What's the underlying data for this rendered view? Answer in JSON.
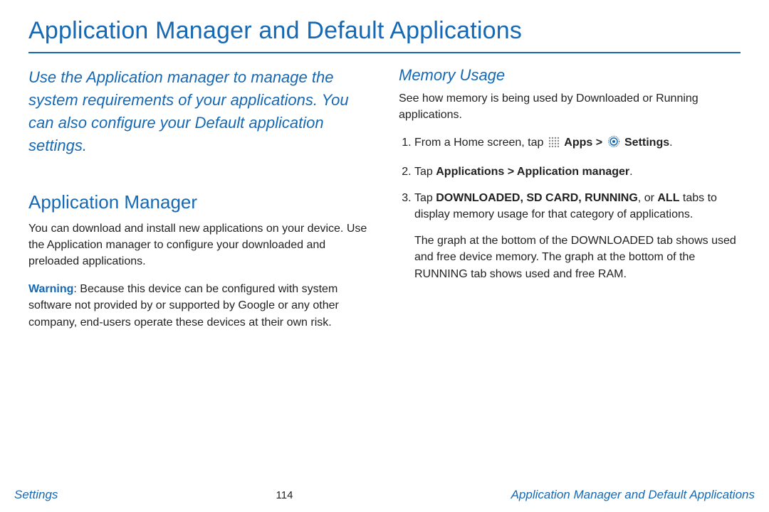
{
  "title": "Application Manager and Default Applications",
  "intro": "Use the Application manager to manage the system requirements of your applications. You can also configure your Default application settings.",
  "left": {
    "heading": "Application Manager",
    "para": "You can download and install new applications on your device. Use the Application manager to configure your downloaded and preloaded applications.",
    "warning_label": "Warning",
    "warning_text": ": Because this device can be configured with system software not provided by or supported by Google or any other company, end-users operate these devices at their own risk."
  },
  "right": {
    "heading": "Memory Usage",
    "para": "See how memory is being used by Downloaded or Running applications.",
    "step1_pre": "From a Home screen, tap ",
    "step1_apps": "Apps",
    "step1_gt": " > ",
    "step1_settings": "Settings",
    "step1_post": ".",
    "step2_pre": "Tap ",
    "step2_bold": "Applications > Application manager",
    "step2_post": ".",
    "step3_pre": "Tap ",
    "step3_bold": "DOWNLOADED, SD CARD, RUNNING",
    "step3_mid": ", or ",
    "step3_all": "ALL",
    "step3_post": " tabs to display memory usage for that category of applications.",
    "graph_para": "The graph at the bottom of the DOWNLOADED tab shows used and free device memory. The graph at the bottom of the RUNNING tab shows used and free RAM."
  },
  "footer": {
    "left": "Settings",
    "center": "114",
    "right": "Application Manager and Default Applications"
  }
}
